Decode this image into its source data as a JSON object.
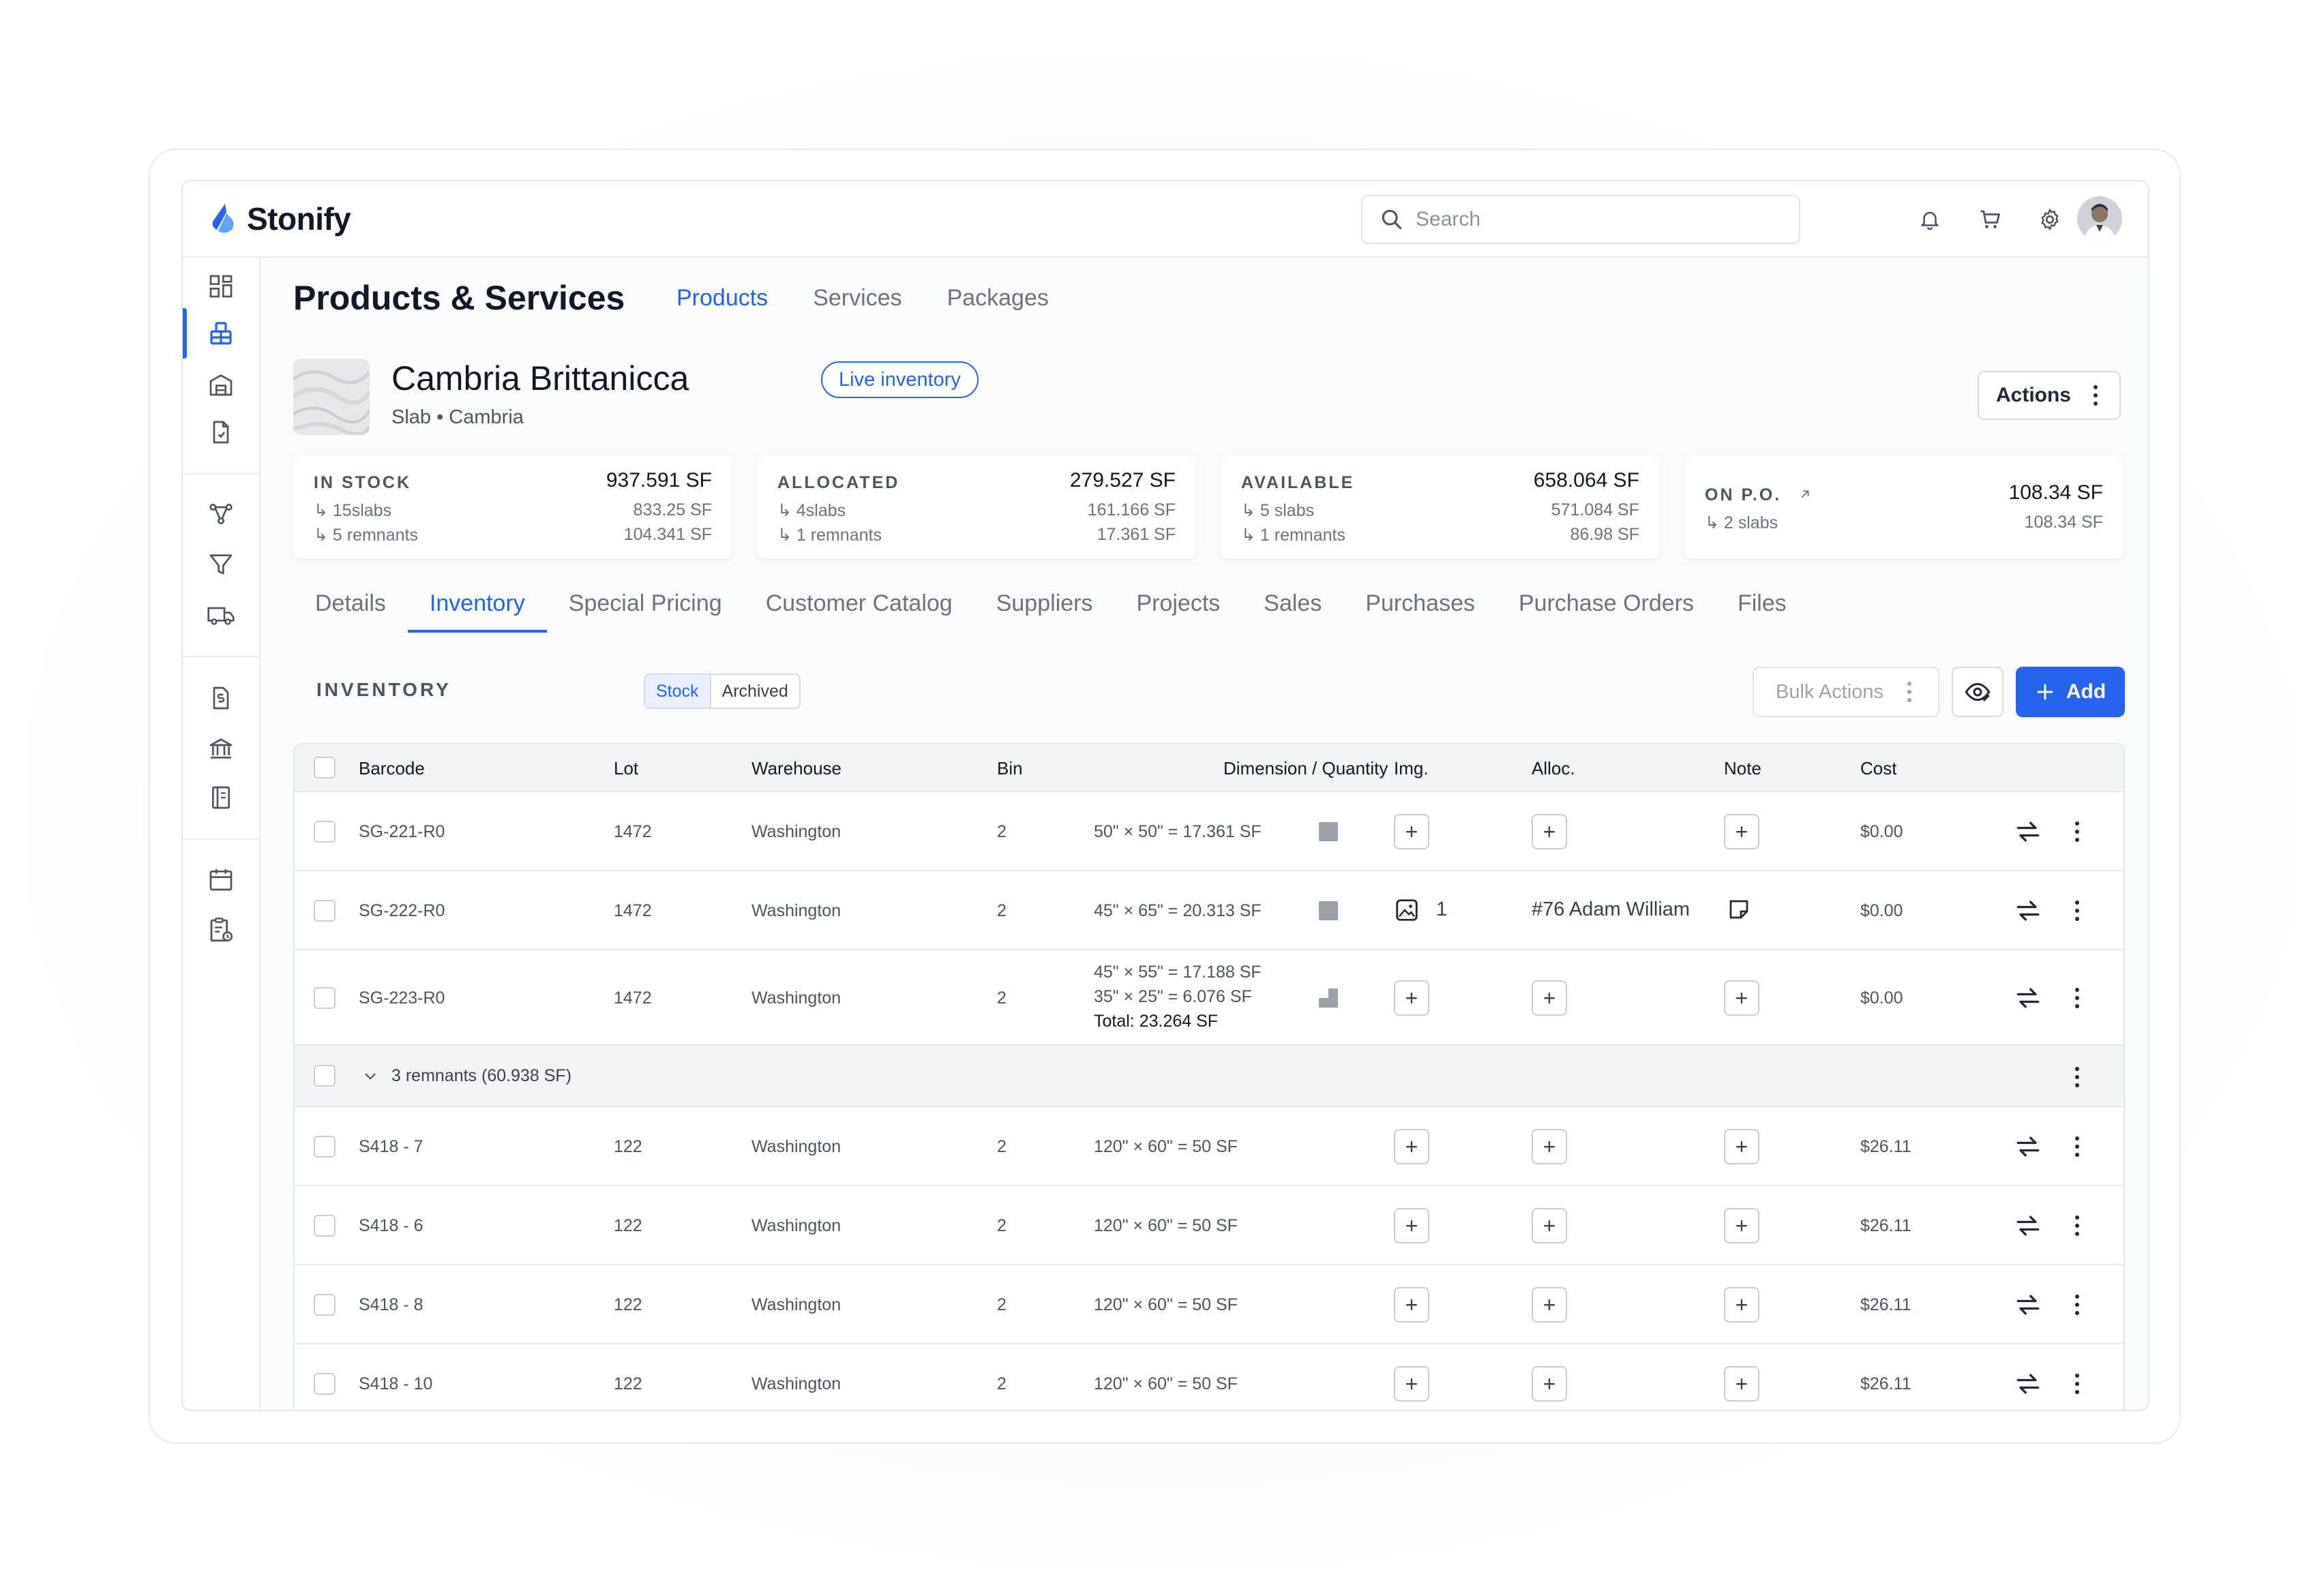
{
  "app": {
    "brand": "Stonify"
  },
  "search": {
    "placeholder": "Search"
  },
  "page": {
    "title": "Products & Services",
    "top_tabs": [
      "Products",
      "Services",
      "Packages"
    ],
    "active_top_tab": "Products"
  },
  "product": {
    "name": "Cambria Brittanicca",
    "badge": "Live inventory",
    "subtitle": "Slab • Cambria",
    "actions_label": "Actions"
  },
  "stats": [
    {
      "label": "IN STOCK",
      "value": "937.591 SF",
      "lines": [
        {
          "text": "15slabs",
          "num": "833.25 SF"
        },
        {
          "text": "5 remnants",
          "num": "104.341 SF"
        }
      ]
    },
    {
      "label": "ALLOCATED",
      "value": "279.527 SF",
      "lines": [
        {
          "text": "4slabs",
          "num": "161.166 SF"
        },
        {
          "text": "1 remnants",
          "num": "17.361 SF"
        }
      ]
    },
    {
      "label": "AVAILABLE",
      "value": "658.064 SF",
      "lines": [
        {
          "text": "5 slabs",
          "num": "571.084 SF"
        },
        {
          "text": "1 remnants",
          "num": "86.98 SF"
        }
      ]
    },
    {
      "label": "ON P.O.",
      "value": "108.34 SF",
      "lines": [
        {
          "text": "2 slabs",
          "num": "108.34 SF"
        }
      ]
    }
  ],
  "detail_tabs": [
    "Details",
    "Inventory",
    "Special Pricing",
    "Customer Catalog",
    "Suppliers",
    "Projects",
    "Sales",
    "Purchases",
    "Purchase Orders",
    "Files"
  ],
  "active_detail_tab": "Inventory",
  "inventory": {
    "label": "INVENTORY",
    "segments": [
      "Stock",
      "Archived"
    ],
    "bulk_label": "Bulk Actions",
    "add_label": "Add"
  },
  "table": {
    "headers": [
      "Barcode",
      "Lot",
      "Warehouse",
      "Bin",
      "Dimension / Quantity",
      "Img.",
      "Alloc.",
      "Note",
      "Cost"
    ],
    "rows": [
      {
        "barcode": "SG-221-R0",
        "lot": "1472",
        "warehouse": "Washington",
        "bin": "2",
        "dims": [
          "50\" × 50\" = 17.361 SF"
        ],
        "cost": "$0.00"
      },
      {
        "barcode": "SG-222-R0",
        "lot": "1472",
        "warehouse": "Washington",
        "bin": "2",
        "dims": [
          "45\" × 65\" = 20.313 SF"
        ],
        "img_count": "1",
        "alloc": "#76 Adam William",
        "cost": "$0.00"
      },
      {
        "barcode": "SG-223-R0",
        "lot": "1472",
        "warehouse": "Washington",
        "bin": "2",
        "dims": [
          "45\" × 55\" = 17.188 SF",
          "35\" × 25\" = 6.076 SF",
          "Total: 23.264 SF"
        ],
        "cost": "$0.00"
      }
    ],
    "group_label": "3 remnants (60.938 SF)",
    "remnant_rows": [
      {
        "barcode": "S418 - 7",
        "lot": "122",
        "warehouse": "Washington",
        "bin": "2",
        "dims": "120\" × 60\" = 50 SF",
        "cost": "$26.11"
      },
      {
        "barcode": "S418 - 6",
        "lot": "122",
        "warehouse": "Washington",
        "bin": "2",
        "dims": "120\" × 60\" = 50 SF",
        "cost": "$26.11"
      },
      {
        "barcode": "S418 - 8",
        "lot": "122",
        "warehouse": "Washington",
        "bin": "2",
        "dims": "120\" × 60\" = 50 SF",
        "cost": "$26.11"
      },
      {
        "barcode": "S418 - 10",
        "lot": "122",
        "warehouse": "Washington",
        "bin": "2",
        "dims": "120\" × 60\" = 50 SF",
        "cost": "$26.11"
      }
    ]
  },
  "colors": {
    "accent": "#2563eb",
    "swatch": "#9aa0a8"
  },
  "icons": [
    "search-icon",
    "bell-icon",
    "cart-icon",
    "gear-icon",
    "help-icon",
    "dashboard-icon",
    "inventory-icon",
    "warehouse-icon",
    "document-icon",
    "workflow-icon",
    "filter-icon",
    "truck-icon",
    "invoice-icon",
    "bank-icon",
    "book-icon",
    "calendar-icon",
    "clipboard-icon",
    "eye-icon",
    "plus-icon",
    "kebab-icon",
    "transfer-icon",
    "image-icon",
    "note-icon",
    "chevron-down-icon",
    "external-arrow-icon"
  ]
}
